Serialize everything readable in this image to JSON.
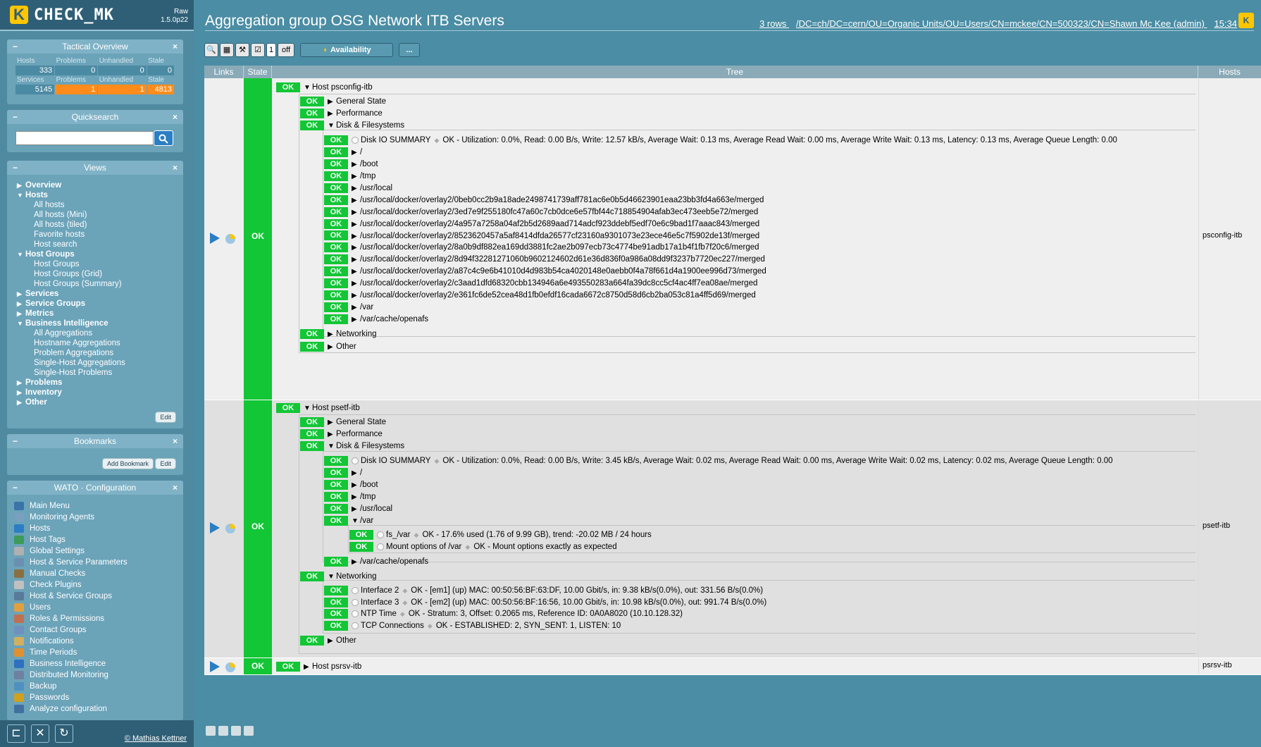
{
  "sidebar": {
    "logo_text": "CHECK_MK",
    "logo_k": "K",
    "edition": "Raw",
    "version": "1.5.0p22",
    "tactical": {
      "title": "Tactical Overview",
      "hosts_headers": [
        "Hosts",
        "Problems",
        "Unhandled",
        "Stale"
      ],
      "hosts_values": [
        "333",
        "0",
        "0",
        "0"
      ],
      "services_headers": [
        "Services",
        "Problems",
        "Unhandled",
        "Stale"
      ],
      "services_values": [
        "5145",
        "1",
        "1",
        "4813"
      ]
    },
    "quicksearch": {
      "title": "Quicksearch",
      "placeholder": ""
    },
    "views": {
      "title": "Views",
      "items": [
        {
          "label": "Overview",
          "type": "t",
          "arrow": "▶"
        },
        {
          "label": "Hosts",
          "type": "t",
          "arrow": "▼"
        },
        {
          "label": "All hosts",
          "type": "s"
        },
        {
          "label": "All hosts (Mini)",
          "type": "s"
        },
        {
          "label": "All hosts (tiled)",
          "type": "s"
        },
        {
          "label": "Favorite hosts",
          "type": "s"
        },
        {
          "label": "Host search",
          "type": "s"
        },
        {
          "label": "Host Groups",
          "type": "t",
          "arrow": "▼"
        },
        {
          "label": "Host Groups",
          "type": "s"
        },
        {
          "label": "Host Groups (Grid)",
          "type": "s"
        },
        {
          "label": "Host Groups (Summary)",
          "type": "s"
        },
        {
          "label": "Services",
          "type": "t",
          "arrow": "▶"
        },
        {
          "label": "Service Groups",
          "type": "t",
          "arrow": "▶"
        },
        {
          "label": "Metrics",
          "type": "t",
          "arrow": "▶"
        },
        {
          "label": "Business Intelligence",
          "type": "t",
          "arrow": "▼"
        },
        {
          "label": "All Aggregations",
          "type": "s"
        },
        {
          "label": "Hostname Aggregations",
          "type": "s"
        },
        {
          "label": "Problem Aggregations",
          "type": "s"
        },
        {
          "label": "Single-Host Aggregations",
          "type": "s"
        },
        {
          "label": "Single-Host Problems",
          "type": "s"
        },
        {
          "label": "Problems",
          "type": "t",
          "arrow": "▶"
        },
        {
          "label": "Inventory",
          "type": "t",
          "arrow": "▶"
        },
        {
          "label": "Other",
          "type": "t",
          "arrow": "▶"
        }
      ],
      "edit": "Edit"
    },
    "bookmarks": {
      "title": "Bookmarks",
      "add": "Add Bookmark",
      "edit": "Edit"
    },
    "wato": {
      "title": "WATO · Configuration",
      "items": [
        "Main Menu",
        "Monitoring Agents",
        "Hosts",
        "Host Tags",
        "Global Settings",
        "Host & Service Parameters",
        "Manual Checks",
        "Check Plugins",
        "Host & Service Groups",
        "Users",
        "Roles & Permissions",
        "Contact Groups",
        "Notifications",
        "Time Periods",
        "Business Intelligence",
        "Distributed Monitoring",
        "Backup",
        "Passwords",
        "Analyze configuration"
      ]
    },
    "copyright": "© Mathias Kettner"
  },
  "header": {
    "title": "Aggregation group OSG Network ITB Servers",
    "rows": "3 rows",
    "user": "/DC=ch/DC=cern/OU=Organic Units/OU=Users/CN=mckee/CN=500323/CN=Shawn Mc Kee (admin)",
    "time": "15:34"
  },
  "toolbar": {
    "count": "1",
    "off": "off",
    "availability": "Availability",
    "more": "..."
  },
  "table": {
    "headers": [
      "Links",
      "State",
      "Tree",
      "Hosts"
    ],
    "ok": "OK",
    "row1": {
      "host": "Host psconfig-itb",
      "hostname": "psconfig-itb",
      "general": "General State",
      "performance": "Performance",
      "disk": "Disk & Filesystems",
      "disk_io": "Disk IO SUMMARY",
      "disk_io_out": "OK - Utilization: 0.0%, Read: 0.00 B/s, Write: 12.57 kB/s, Average Wait: 0.13 ms, Average Read Wait: 0.00 ms, Average Write Wait: 0.13 ms, Latency: 0.13 ms, Average Queue Length: 0.00",
      "fs": [
        "/",
        "/boot",
        "/tmp",
        "/usr/local",
        "/usr/local/docker/overlay2/0beb0cc2b9a18ade2498741739aff781ac6e0b5d46623901eaa23bb3fd4a663e/merged",
        "/usr/local/docker/overlay2/3ed7e9f255180fc47a60c7cb0dce6e57fbf44c718854904afab3ec473eeb5e72/merged",
        "/usr/local/docker/overlay2/4a957a7258a04af2b5d2689aad714adcf923ddebf5edf70e6c9bad1f7aaac843/merged",
        "/usr/local/docker/overlay2/8523620457a5af8414dfda26577cf23160a9301073e23ece46e5c7f5902de13f/merged",
        "/usr/local/docker/overlay2/8a0b9df882ea169dd3881fc2ae2b097ecb73c4774be91adb17a1b4f1fb7f20c6/merged",
        "/usr/local/docker/overlay2/8d94f32281271060b9602124602d61e36d836f0a986a08dd9f3237b7720ec227/merged",
        "/usr/local/docker/overlay2/a87c4c9e6b41010d4d983b54ca4020148e0aebb0f4a78f661d4a1900ee996d73/merged",
        "/usr/local/docker/overlay2/c3aad1dfd68320cbb134946a6e493550283a664fa39dc8cc5cf4ac4ff7ea08ae/merged",
        "/usr/local/docker/overlay2/e361fc6de52cea48d1fb0efdf16cada6672c8750d58d6cb2ba053c81a4ff5d69/merged",
        "/var",
        "/var/cache/openafs"
      ],
      "networking": "Networking",
      "other": "Other"
    },
    "row2": {
      "host": "Host psetf-itb",
      "hostname": "psetf-itb",
      "general": "General State",
      "performance": "Performance",
      "disk": "Disk & Filesystems",
      "disk_io": "Disk IO SUMMARY",
      "disk_io_out": "OK - Utilization: 0.0%, Read: 0.00 B/s, Write: 3.45 kB/s, Average Wait: 0.02 ms, Average Read Wait: 0.00 ms, Average Write Wait: 0.02 ms, Latency: 0.02 ms, Average Queue Length: 0.00",
      "fs": [
        "/",
        "/boot",
        "/tmp",
        "/usr/local",
        "/var"
      ],
      "fs_var": "fs_/var",
      "fs_var_out": "OK - 17.6% used (1.76 of 9.99 GB), trend: -20.02 MB / 24 hours",
      "mount": "Mount options of /var",
      "mount_out": "OK - Mount options exactly as expected",
      "cache": "/var/cache/openafs",
      "networking": "Networking",
      "net": [
        {
          "name": "Interface 2",
          "out": "OK - [em1] (up) MAC: 00:50:56:BF:63:DF, 10.00 Gbit/s, in: 9.38 kB/s(0.0%), out: 331.56 B/s(0.0%)"
        },
        {
          "name": "Interface 3",
          "out": "OK - [em2] (up) MAC: 00:50:56:BF:16:56, 10.00 Gbit/s, in: 10.98 kB/s(0.0%), out: 991.74 B/s(0.0%)"
        },
        {
          "name": "NTP Time",
          "out": "OK - Stratum: 3, Offset: 0.2065 ms, Reference ID: 0A0A8020 (10.10.128.32)"
        },
        {
          "name": "TCP Connections",
          "out": "OK - ESTABLISHED: 2, SYN_SENT: 1, LISTEN: 10"
        }
      ],
      "other": "Other"
    },
    "row3": {
      "host": "Host psrsv-itb",
      "hostname": "psrsv-itb"
    }
  },
  "colors": {
    "ok": "#12c636",
    "sidebar": "#508aa1",
    "accent": "#ffc600"
  }
}
